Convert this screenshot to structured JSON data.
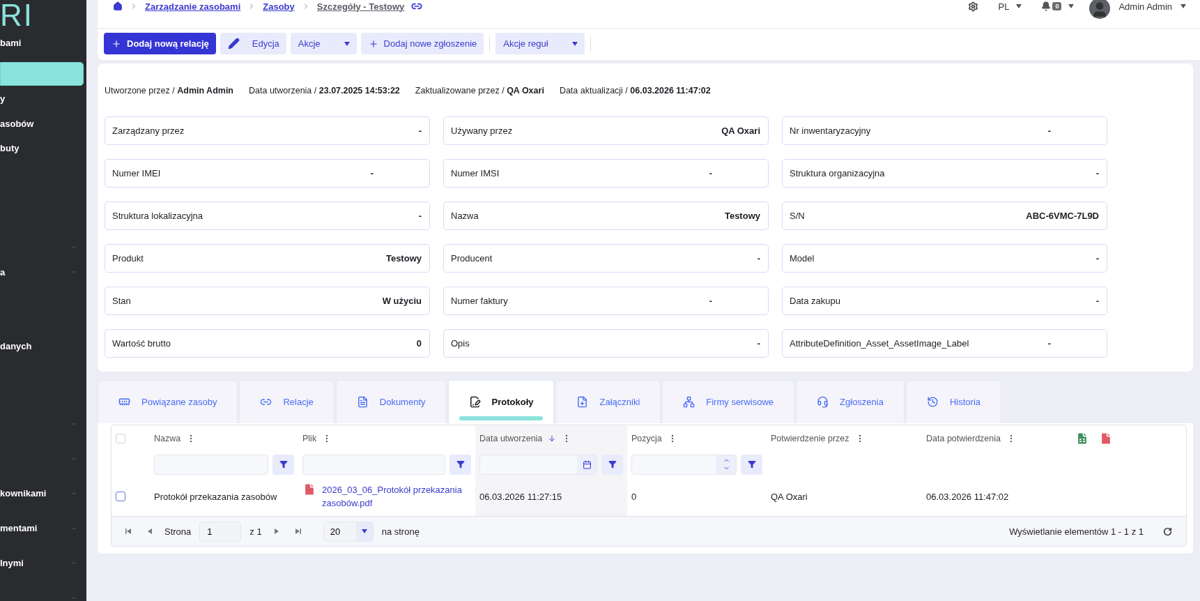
{
  "sidebar": {
    "logo": "RI",
    "items": [
      {
        "label": "bami",
        "selected": false,
        "expandable": false
      },
      {
        "selected": true,
        "expandable": false
      },
      {
        "label": "y",
        "selected": false,
        "expandable": false
      },
      {
        "label": "asobów",
        "selected": false,
        "expandable": false
      },
      {
        "label": "buty",
        "selected": false,
        "expandable": false
      },
      {
        "selected": false,
        "expandable": false
      },
      {
        "selected": false,
        "expandable": false
      },
      {
        "selected": false,
        "expandable": false
      },
      {
        "selected": false,
        "expandable": true
      },
      {
        "label": "a",
        "selected": false,
        "expandable": true
      },
      {
        "selected": false,
        "expandable": false
      },
      {
        "selected": false,
        "expandable": false
      },
      {
        "label": "danych",
        "selected": false,
        "expandable": false
      }
    ],
    "bottom_items": [
      {
        "selected": false,
        "expandable": true
      },
      {
        "selected": false,
        "expandable": true
      },
      {
        "label": "kownikami",
        "selected": false,
        "expandable": true
      },
      {
        "label": "mentami",
        "selected": false,
        "expandable": true
      },
      {
        "label": "lnymi",
        "selected": false,
        "expandable": true
      },
      {
        "selected": false,
        "expandable": true
      }
    ]
  },
  "breadcrumbs": [
    {
      "label": "Zarządzanie zasobami",
      "kind": "link"
    },
    {
      "label": "Zasoby",
      "kind": "link"
    },
    {
      "label": "Szczegóły - Testowy",
      "kind": "current"
    }
  ],
  "header": {
    "language": "PL",
    "notifications": "0",
    "user": "Admin Admin"
  },
  "toolbar": {
    "groups": [
      [
        {
          "label": "Dodaj nową relację",
          "kind": "primary"
        },
        {
          "label": "Edycja",
          "kind": "edit"
        },
        {
          "label": "Akcje",
          "kind": "dropdown"
        },
        {
          "label": "Dodaj nowe zgłoszenie",
          "kind": "add"
        }
      ],
      [
        {
          "label": "Akcje reguł",
          "kind": "dropdown"
        }
      ]
    ]
  },
  "meta": [
    "Utworzone przez / **Admin Admin**",
    "Data utworzenia / **23.07.2025 14:53:22**",
    "Zaktualizowane przez / **QA Oxari**",
    "Data aktualizacji / **06.03.2026 11:47:02**"
  ],
  "fields": [
    {
      "label": "Zarządzany przez",
      "value": "-",
      "kind": "end"
    },
    {
      "label": "Używany przez",
      "value": "QA Oxari",
      "kind": "end"
    },
    {
      "label": "Nr inwentaryzacyjny",
      "value": "-",
      "kind": "offset"
    },
    {
      "label": "Numer IMEI",
      "value": "-",
      "kind": "offset"
    },
    {
      "label": "Numer IMSI",
      "value": "-",
      "kind": "offset"
    },
    {
      "label": "Struktura organizacyjna",
      "value": "-",
      "kind": "end"
    },
    {
      "label": "Struktura lokalizacyjna",
      "value": "-",
      "kind": "end"
    },
    {
      "label": "Nazwa",
      "value": "Testowy",
      "kind": "end"
    },
    {
      "label": "S/N",
      "value": "ABC-6VMC-7L9D",
      "kind": "end"
    },
    {
      "label": "Produkt",
      "value": "Testowy",
      "kind": "end"
    },
    {
      "label": "Producent",
      "value": "-",
      "kind": "end"
    },
    {
      "label": "Model",
      "value": "-",
      "kind": "end"
    },
    {
      "label": "Stan",
      "value": "W użyciu",
      "kind": "end"
    },
    {
      "label": "Numer faktury",
      "value": "-",
      "kind": "offset"
    },
    {
      "label": "Data zakupu",
      "value": "-",
      "kind": "end"
    },
    {
      "label": "Wartość brutto",
      "value": "0",
      "kind": "end"
    },
    {
      "label": "Opis",
      "value": "-",
      "kind": "end"
    },
    {
      "label": "AttributeDefinition_Asset_AssetImage_Label",
      "value": "-",
      "kind": "offset"
    }
  ],
  "tabs": [
    {
      "label": "Powiązane zasoby",
      "selected": false,
      "kind": "assets"
    },
    {
      "label": "Relacje",
      "selected": false,
      "kind": "relations"
    },
    {
      "label": "Dokumenty",
      "selected": false,
      "kind": "documents"
    },
    {
      "label": "Protokoły",
      "selected": true,
      "kind": "protocols"
    },
    {
      "label": "Załączniki",
      "selected": false,
      "kind": "attachments"
    },
    {
      "label": "Firmy serwisowe",
      "selected": false,
      "kind": "companies"
    },
    {
      "label": "Zgłoszenia",
      "selected": false,
      "kind": "tickets"
    },
    {
      "label": "Historia",
      "selected": false,
      "kind": "history"
    }
  ],
  "table": {
    "select_all_checked": false,
    "columns": [
      {
        "label": "Nazwa",
        "sorted": false,
        "kind": "text"
      },
      {
        "label": "Plik",
        "sorted": false,
        "kind": "file"
      },
      {
        "label": "Data utworzenia",
        "sorted": true,
        "kind": "date"
      },
      {
        "label": "Pozycja",
        "sorted": false,
        "kind": "number"
      },
      {
        "label": "Potwierdzenie przez",
        "sorted": false,
        "kind": "plain"
      },
      {
        "label": "Data potwierdzenia",
        "sorted": false,
        "kind": "plain"
      }
    ],
    "rows": [
      {
        "checked": false,
        "cells": [
          "Protokół przekazania zasobów",
          "2026_03_06_Protokół przekazania zasobów.pdf",
          "06.03.2026 11:27:15",
          "0",
          "QA Oxari",
          "06.03.2026 11:47:02"
        ]
      }
    ],
    "pager": {
      "page_label": "Strona",
      "page": "1",
      "of": "z 1",
      "page_size": "20",
      "per_page": "na stronę",
      "summary": "Wyświetlanie elementów 1 - 1 z 1"
    }
  }
}
